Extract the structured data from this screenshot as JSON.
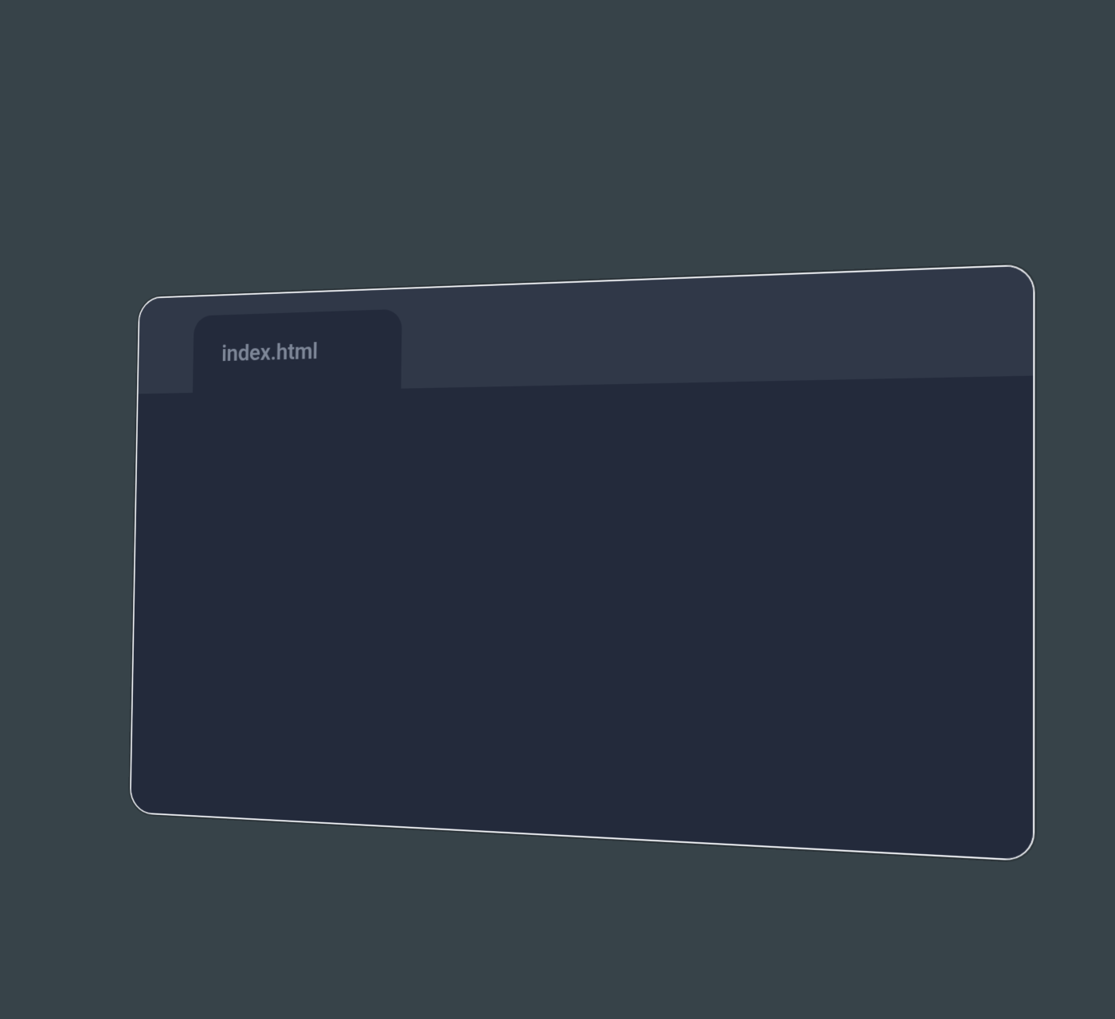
{
  "editor": {
    "tab_label": "index.html"
  }
}
